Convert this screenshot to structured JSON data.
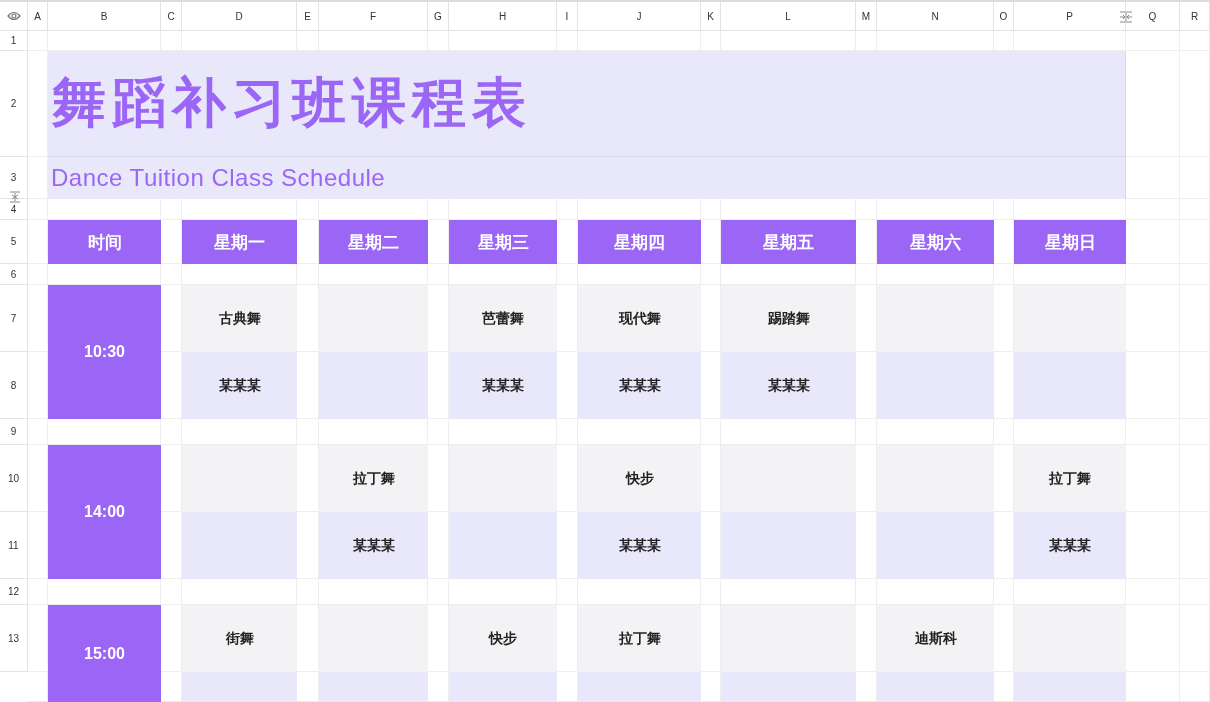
{
  "column_headers": [
    "A",
    "B",
    "C",
    "D",
    "E",
    "F",
    "G",
    "H",
    "I",
    "J",
    "K",
    "L",
    "M",
    "N",
    "O",
    "P",
    "Q",
    "R"
  ],
  "row_headers": [
    "1",
    "2",
    "3",
    "4",
    "5",
    "6",
    "7",
    "8",
    "9",
    "10",
    "11",
    "12",
    "13"
  ],
  "title": "舞蹈补习班课程表",
  "subtitle": "Dance Tuition Class Schedule",
  "header_row": [
    "时间",
    "星期一",
    "星期二",
    "星期三",
    "星期四",
    "星期五",
    "星期六",
    "星期日"
  ],
  "slots": [
    {
      "time": "10:30",
      "days": [
        {
          "kind": "class",
          "course": "古典舞",
          "teacher": "某某某"
        },
        {
          "kind": "empty"
        },
        {
          "kind": "class",
          "course": "芭蕾舞",
          "teacher": "某某某"
        },
        {
          "kind": "class",
          "course": "现代舞",
          "teacher": "某某某"
        },
        {
          "kind": "class",
          "course": "踢踏舞",
          "teacher": "某某某"
        },
        {
          "kind": "empty"
        },
        {
          "kind": "empty"
        }
      ]
    },
    {
      "time": "14:00",
      "days": [
        {
          "kind": "empty"
        },
        {
          "kind": "class",
          "course": "拉丁舞",
          "teacher": "某某某"
        },
        {
          "kind": "empty"
        },
        {
          "kind": "class",
          "course": "快步",
          "teacher": "某某某"
        },
        {
          "kind": "empty"
        },
        {
          "kind": "empty"
        },
        {
          "kind": "class",
          "course": "拉丁舞",
          "teacher": "某某某"
        }
      ]
    },
    {
      "time": "15:00",
      "days": [
        {
          "kind": "class",
          "course": "街舞"
        },
        {
          "kind": "empty"
        },
        {
          "kind": "class",
          "course": "快步"
        },
        {
          "kind": "class",
          "course": "拉丁舞"
        },
        {
          "kind": "empty"
        },
        {
          "kind": "class",
          "course": "迪斯科"
        },
        {
          "kind": "empty"
        }
      ]
    }
  ]
}
